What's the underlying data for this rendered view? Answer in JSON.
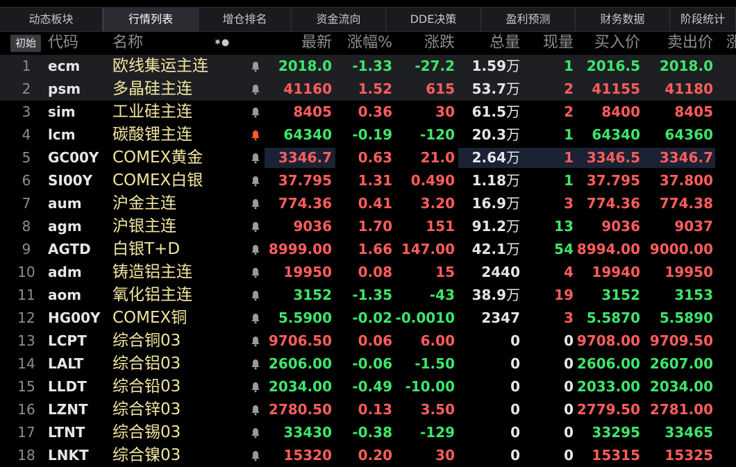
{
  "tabs": [
    {
      "label": "动态板块",
      "active": false
    },
    {
      "label": "行情列表",
      "active": true
    },
    {
      "label": "增仓排名",
      "active": false
    },
    {
      "label": "资金流向",
      "active": false
    },
    {
      "label": "DDE决策",
      "active": false
    },
    {
      "label": "盈利预测",
      "active": false
    },
    {
      "label": "财务数据",
      "active": false
    },
    {
      "label": "阶段统计",
      "active": false
    }
  ],
  "reset_label": "初始",
  "sort_icon": "✷●",
  "headers": {
    "code": "代码",
    "name": "名称",
    "last": "最新",
    "pct": "涨幅%",
    "chg": "涨跌",
    "vol": "总量",
    "cur": "现量",
    "bid": "买入价",
    "ask": "卖出价",
    "more": "涨"
  },
  "colors": {
    "up": "#ff5d5d",
    "down": "#3ee66b",
    "flat": "#e6e6e6",
    "name": "#f2e6a0",
    "alert_bell": "#ff5a2a",
    "bell": "#9a9a9a",
    "highlight": "#1a2234"
  },
  "rows": [
    {
      "num": "1",
      "code": "ecm",
      "name": "欧线集运主连",
      "last": "2018.0",
      "pct": "-1.33",
      "chg": "-27.2",
      "vol": "1.59",
      "vol_unit": "万",
      "cur": "1",
      "bid": "2016.5",
      "ask": "2018.0",
      "dir": "down",
      "bid_dir": "down",
      "ask_dir": "down",
      "cur_dir": "down",
      "alert": false,
      "selected": true,
      "hl": false
    },
    {
      "num": "2",
      "code": "psm",
      "name": "多晶硅主连",
      "last": "41160",
      "pct": "1.52",
      "chg": "615",
      "vol": "53.7",
      "vol_unit": "万",
      "cur": "2",
      "bid": "41155",
      "ask": "41180",
      "dir": "up",
      "bid_dir": "up",
      "ask_dir": "up",
      "cur_dir": "up",
      "alert": false,
      "selected": true,
      "hl": false
    },
    {
      "num": "3",
      "code": "sim",
      "name": "工业硅主连",
      "last": "8405",
      "pct": "0.36",
      "chg": "30",
      "vol": "61.5",
      "vol_unit": "万",
      "cur": "2",
      "bid": "8400",
      "ask": "8405",
      "dir": "up",
      "bid_dir": "up",
      "ask_dir": "up",
      "cur_dir": "up",
      "alert": false,
      "selected": false,
      "hl": false
    },
    {
      "num": "4",
      "code": "lcm",
      "name": "碳酸锂主连",
      "last": "64340",
      "pct": "-0.19",
      "chg": "-120",
      "vol": "20.3",
      "vol_unit": "万",
      "cur": "1",
      "bid": "64340",
      "ask": "64360",
      "dir": "down",
      "bid_dir": "down",
      "ask_dir": "down",
      "cur_dir": "down",
      "alert": true,
      "selected": false,
      "hl": false
    },
    {
      "num": "5",
      "code": "GC00Y",
      "name": "COMEX黄金",
      "last": "3346.7",
      "pct": "0.63",
      "chg": "21.0",
      "vol": "2.64",
      "vol_unit": "万",
      "cur": "1",
      "bid": "3346.5",
      "ask": "3346.7",
      "dir": "up",
      "bid_dir": "up",
      "ask_dir": "up",
      "cur_dir": "up",
      "alert": false,
      "selected": false,
      "hl": true
    },
    {
      "num": "6",
      "code": "SI00Y",
      "name": "COMEX白银",
      "last": "37.795",
      "pct": "1.31",
      "chg": "0.490",
      "vol": "1.18",
      "vol_unit": "万",
      "cur": "1",
      "bid": "37.795",
      "ask": "37.800",
      "dir": "up",
      "bid_dir": "up",
      "ask_dir": "up",
      "cur_dir": "down",
      "alert": false,
      "selected": false,
      "hl": false
    },
    {
      "num": "7",
      "code": "aum",
      "name": "沪金主连",
      "last": "774.36",
      "pct": "0.41",
      "chg": "3.20",
      "vol": "16.9",
      "vol_unit": "万",
      "cur": "3",
      "bid": "774.36",
      "ask": "774.38",
      "dir": "up",
      "bid_dir": "up",
      "ask_dir": "up",
      "cur_dir": "up",
      "alert": false,
      "selected": false,
      "hl": false
    },
    {
      "num": "8",
      "code": "agm",
      "name": "沪银主连",
      "last": "9036",
      "pct": "1.70",
      "chg": "151",
      "vol": "91.2",
      "vol_unit": "万",
      "cur": "13",
      "bid": "9036",
      "ask": "9037",
      "dir": "up",
      "bid_dir": "up",
      "ask_dir": "up",
      "cur_dir": "down",
      "alert": false,
      "selected": false,
      "hl": false
    },
    {
      "num": "9",
      "code": "AGTD",
      "name": "白银T+D",
      "last": "8999.00",
      "pct": "1.66",
      "chg": "147.00",
      "vol": "42.1",
      "vol_unit": "万",
      "cur": "54",
      "bid": "8994.00",
      "ask": "9000.00",
      "dir": "up",
      "bid_dir": "up",
      "ask_dir": "up",
      "cur_dir": "down",
      "alert": false,
      "selected": false,
      "hl": false
    },
    {
      "num": "10",
      "code": "adm",
      "name": "铸造铝主连",
      "last": "19950",
      "pct": "0.08",
      "chg": "15",
      "vol": "2440",
      "vol_unit": "",
      "cur": "4",
      "bid": "19940",
      "ask": "19950",
      "dir": "up",
      "bid_dir": "up",
      "ask_dir": "up",
      "cur_dir": "up",
      "alert": false,
      "selected": false,
      "hl": false
    },
    {
      "num": "11",
      "code": "aom",
      "name": "氧化铝主连",
      "last": "3152",
      "pct": "-1.35",
      "chg": "-43",
      "vol": "38.9",
      "vol_unit": "万",
      "cur": "19",
      "bid": "3152",
      "ask": "3153",
      "dir": "down",
      "bid_dir": "down",
      "ask_dir": "down",
      "cur_dir": "up",
      "alert": false,
      "selected": false,
      "hl": false
    },
    {
      "num": "12",
      "code": "HG00Y",
      "name": "COMEX铜",
      "last": "5.5900",
      "pct": "-0.02",
      "chg": "-0.0010",
      "vol": "2347",
      "vol_unit": "",
      "cur": "3",
      "bid": "5.5870",
      "ask": "5.5890",
      "dir": "down",
      "bid_dir": "down",
      "ask_dir": "down",
      "cur_dir": "up",
      "alert": false,
      "selected": false,
      "hl": false
    },
    {
      "num": "13",
      "code": "LCPT",
      "name": "综合铜03",
      "last": "9706.50",
      "pct": "0.06",
      "chg": "6.00",
      "vol": "0",
      "vol_unit": "",
      "cur": "0",
      "bid": "9708.00",
      "ask": "9709.50",
      "dir": "up",
      "bid_dir": "up",
      "ask_dir": "up",
      "cur_dir": "up",
      "alert": false,
      "selected": false,
      "hl": false
    },
    {
      "num": "14",
      "code": "LALT",
      "name": "综合铝03",
      "last": "2606.00",
      "pct": "-0.06",
      "chg": "-1.50",
      "vol": "0",
      "vol_unit": "",
      "cur": "0",
      "bid": "2606.00",
      "ask": "2607.00",
      "dir": "down",
      "bid_dir": "down",
      "ask_dir": "down",
      "cur_dir": "up",
      "alert": false,
      "selected": false,
      "hl": false
    },
    {
      "num": "15",
      "code": "LLDT",
      "name": "综合铅03",
      "last": "2034.00",
      "pct": "-0.49",
      "chg": "-10.00",
      "vol": "0",
      "vol_unit": "",
      "cur": "0",
      "bid": "2033.00",
      "ask": "2034.00",
      "dir": "down",
      "bid_dir": "down",
      "ask_dir": "down",
      "cur_dir": "up",
      "alert": false,
      "selected": false,
      "hl": false
    },
    {
      "num": "16",
      "code": "LZNT",
      "name": "综合锌03",
      "last": "2780.50",
      "pct": "0.13",
      "chg": "3.50",
      "vol": "0",
      "vol_unit": "",
      "cur": "0",
      "bid": "2779.50",
      "ask": "2781.00",
      "dir": "up",
      "bid_dir": "up",
      "ask_dir": "up",
      "cur_dir": "up",
      "alert": false,
      "selected": false,
      "hl": false
    },
    {
      "num": "17",
      "code": "LTNT",
      "name": "综合锡03",
      "last": "33430",
      "pct": "-0.38",
      "chg": "-129",
      "vol": "0",
      "vol_unit": "",
      "cur": "0",
      "bid": "33295",
      "ask": "33465",
      "dir": "down",
      "bid_dir": "down",
      "ask_dir": "down",
      "cur_dir": "up",
      "alert": false,
      "selected": false,
      "hl": false
    },
    {
      "num": "18",
      "code": "LNKT",
      "name": "综合镍03",
      "last": "15320",
      "pct": "0.20",
      "chg": "30",
      "vol": "0",
      "vol_unit": "",
      "cur": "0",
      "bid": "15315",
      "ask": "15325",
      "dir": "up",
      "bid_dir": "up",
      "ask_dir": "up",
      "cur_dir": "up",
      "alert": false,
      "selected": false,
      "hl": false
    }
  ]
}
